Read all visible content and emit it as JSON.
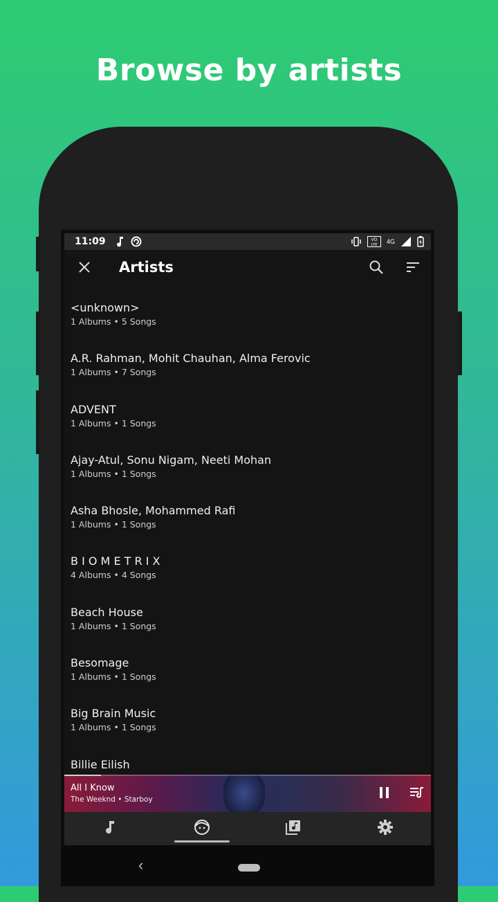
{
  "promo": {
    "headline": "Browse by artists"
  },
  "status_bar": {
    "time": "11:09",
    "network": "4G",
    "volte": "VO LTE",
    "icons": [
      "music-note-icon",
      "sync-icon",
      "vibrate-icon",
      "volte-icon",
      "signal-icon",
      "battery-charging-icon"
    ]
  },
  "app_bar": {
    "title": "Artists",
    "icons": [
      "close-icon",
      "search-icon",
      "sort-icon"
    ]
  },
  "artists": [
    {
      "name": "<unknown>",
      "meta": "1 Albums • 5 Songs"
    },
    {
      "name": "A.R. Rahman, Mohit Chauhan, Alma Ferovic",
      "meta": "1 Albums • 7 Songs"
    },
    {
      "name": "ADVENT",
      "meta": "1 Albums • 1 Songs"
    },
    {
      "name": "Ajay-Atul, Sonu Nigam, Neeti Mohan",
      "meta": "1 Albums • 1 Songs"
    },
    {
      "name": "Asha Bhosle, Mohammed Rafi",
      "meta": "1 Albums • 1 Songs"
    },
    {
      "name": "B I O M E T R I X",
      "meta": "4 Albums • 4 Songs"
    },
    {
      "name": "Beach House",
      "meta": "1 Albums • 1 Songs"
    },
    {
      "name": "Besomage",
      "meta": "1 Albums • 1 Songs"
    },
    {
      "name": "Big Brain Music",
      "meta": "1 Albums • 1 Songs"
    },
    {
      "name": "Billie Eilish",
      "meta": ""
    }
  ],
  "now_playing": {
    "title": "All I Know",
    "subtitle": "The Weeknd • Starboy",
    "progress_fraction": 0.1,
    "icons": [
      "pause-icon",
      "queue-icon"
    ]
  },
  "bottom_nav": {
    "tabs": [
      {
        "icon": "song-icon",
        "active": false
      },
      {
        "icon": "artist-face-icon",
        "active": true
      },
      {
        "icon": "album-library-icon",
        "active": false
      },
      {
        "icon": "gear-icon",
        "active": false
      }
    ]
  },
  "system_nav": {
    "back_glyph": "‹"
  },
  "colors": {
    "gradient_top": "#2ecc71",
    "gradient_bottom": "#3399dd",
    "surface": "#141414",
    "mini_player_accent": "#8a1b3a"
  }
}
